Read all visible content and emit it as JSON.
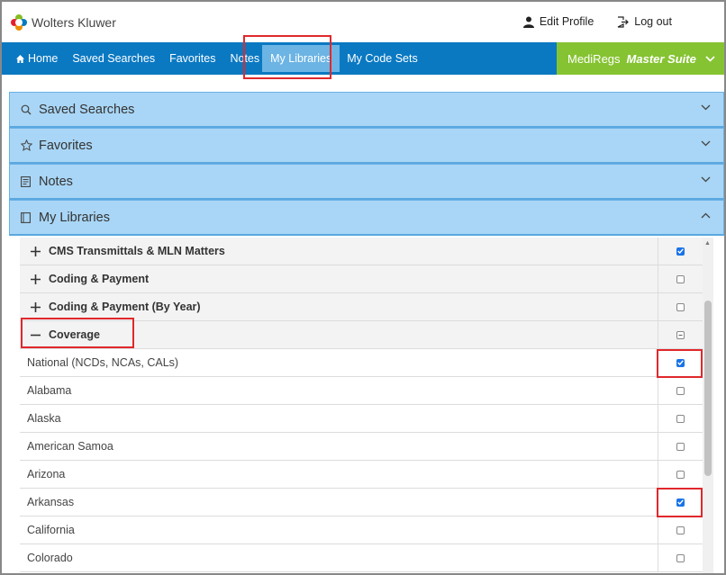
{
  "header": {
    "brand": "Wolters Kluwer",
    "edit_profile": "Edit Profile",
    "log_out": "Log out"
  },
  "nav": {
    "items": [
      {
        "label": "Home",
        "icon": "home-icon"
      },
      {
        "label": "Saved Searches"
      },
      {
        "label": "Favorites"
      },
      {
        "label": "Notes"
      },
      {
        "label": "My Libraries",
        "active": true
      },
      {
        "label": "My Code Sets"
      }
    ],
    "suite_brand": "MediRegs",
    "suite_name": "Master Suite"
  },
  "accordion": {
    "saved_searches": "Saved Searches",
    "favorites": "Favorites",
    "notes": "Notes",
    "my_libraries": "My Libraries"
  },
  "libraries": {
    "groups": [
      {
        "label": "CMS Transmittals & MLN Matters",
        "expanded": false,
        "checked": true
      },
      {
        "label": "Coding & Payment",
        "expanded": false,
        "checked": false
      },
      {
        "label": "Coding & Payment (By Year)",
        "expanded": false,
        "checked": false
      },
      {
        "label": "Coverage",
        "expanded": true,
        "state": "partial"
      }
    ],
    "coverage_items": [
      {
        "label": "National (NCDs, NCAs, CALs)",
        "checked": true
      },
      {
        "label": "Alabama",
        "checked": false
      },
      {
        "label": "Alaska",
        "checked": false
      },
      {
        "label": "American Samoa",
        "checked": false
      },
      {
        "label": "Arizona",
        "checked": false
      },
      {
        "label": "Arkansas",
        "checked": true
      },
      {
        "label": "California",
        "checked": false
      },
      {
        "label": "Colorado",
        "checked": false
      }
    ]
  },
  "colors": {
    "nav_blue": "#0a79c2",
    "suite_green": "#86c332",
    "accordion_blue": "#a9d6f6",
    "highlight_red": "#e0282c"
  }
}
